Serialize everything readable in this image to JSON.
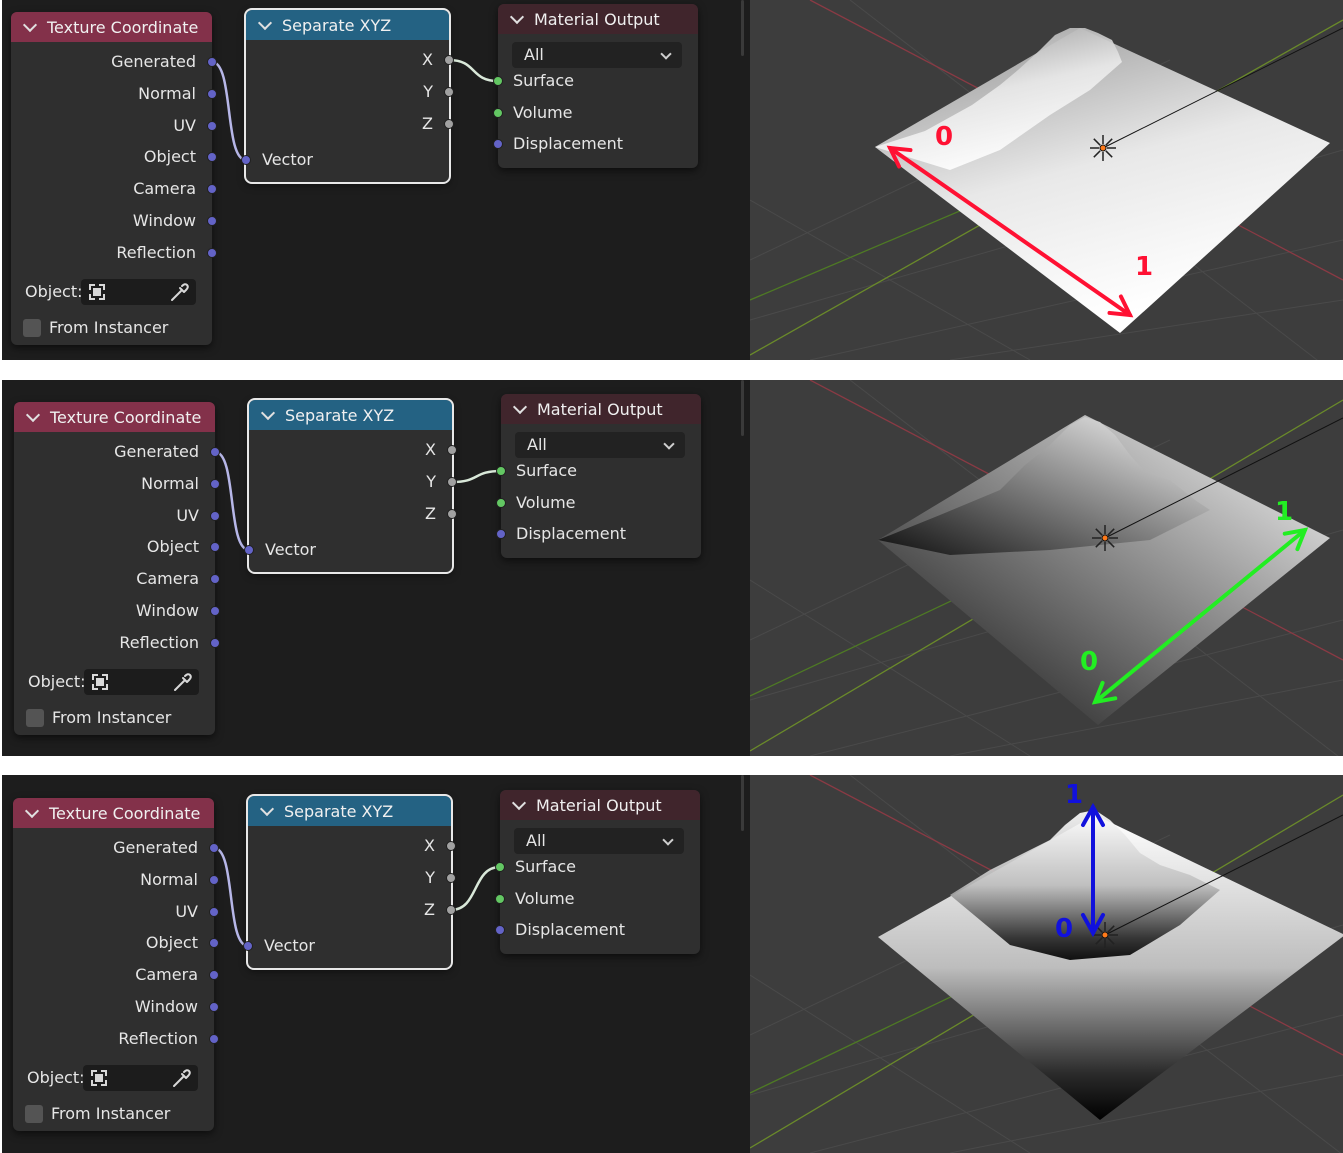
{
  "panels": [
    {
      "texture_coordinate": {
        "title": "Texture Coordinate",
        "outputs": [
          "Generated",
          "Normal",
          "UV",
          "Object",
          "Camera",
          "Window",
          "Reflection"
        ],
        "object_label": "Object:",
        "from_instancer_label": "From Instancer"
      },
      "separate_xyz": {
        "title": "Separate XYZ",
        "outputs": [
          "X",
          "Y",
          "Z"
        ],
        "input": "Vector"
      },
      "material_output": {
        "title": "Material Output",
        "target": "All",
        "inputs": [
          "Surface",
          "Volume",
          "Displacement"
        ]
      },
      "connected_component": "X",
      "annotation": {
        "color": "#ff1133",
        "start_label": "0",
        "end_label": "1"
      }
    },
    {
      "texture_coordinate": {
        "title": "Texture Coordinate",
        "outputs": [
          "Generated",
          "Normal",
          "UV",
          "Object",
          "Camera",
          "Window",
          "Reflection"
        ],
        "object_label": "Object:",
        "from_instancer_label": "From Instancer"
      },
      "separate_xyz": {
        "title": "Separate XYZ",
        "outputs": [
          "X",
          "Y",
          "Z"
        ],
        "input": "Vector"
      },
      "material_output": {
        "title": "Material Output",
        "target": "All",
        "inputs": [
          "Surface",
          "Volume",
          "Displacement"
        ]
      },
      "connected_component": "Y",
      "annotation": {
        "color": "#22ee22",
        "start_label": "0",
        "end_label": "1"
      }
    },
    {
      "texture_coordinate": {
        "title": "Texture Coordinate",
        "outputs": [
          "Generated",
          "Normal",
          "UV",
          "Object",
          "Camera",
          "Window",
          "Reflection"
        ],
        "object_label": "Object:",
        "from_instancer_label": "From Instancer"
      },
      "separate_xyz": {
        "title": "Separate XYZ",
        "outputs": [
          "X",
          "Y",
          "Z"
        ],
        "input": "Vector"
      },
      "material_output": {
        "title": "Material Output",
        "target": "All",
        "inputs": [
          "Surface",
          "Volume",
          "Displacement"
        ]
      },
      "connected_component": "Z",
      "annotation": {
        "color": "#1111dd",
        "start_label": "0",
        "end_label": "1"
      }
    }
  ],
  "colors": {
    "input_node_header": "#83314a",
    "converter_node_header": "#246283",
    "output_node_header": "#40252c",
    "vector_socket": "#6363c7",
    "float_socket": "#a1a1a1",
    "shader_socket": "#63c763"
  }
}
